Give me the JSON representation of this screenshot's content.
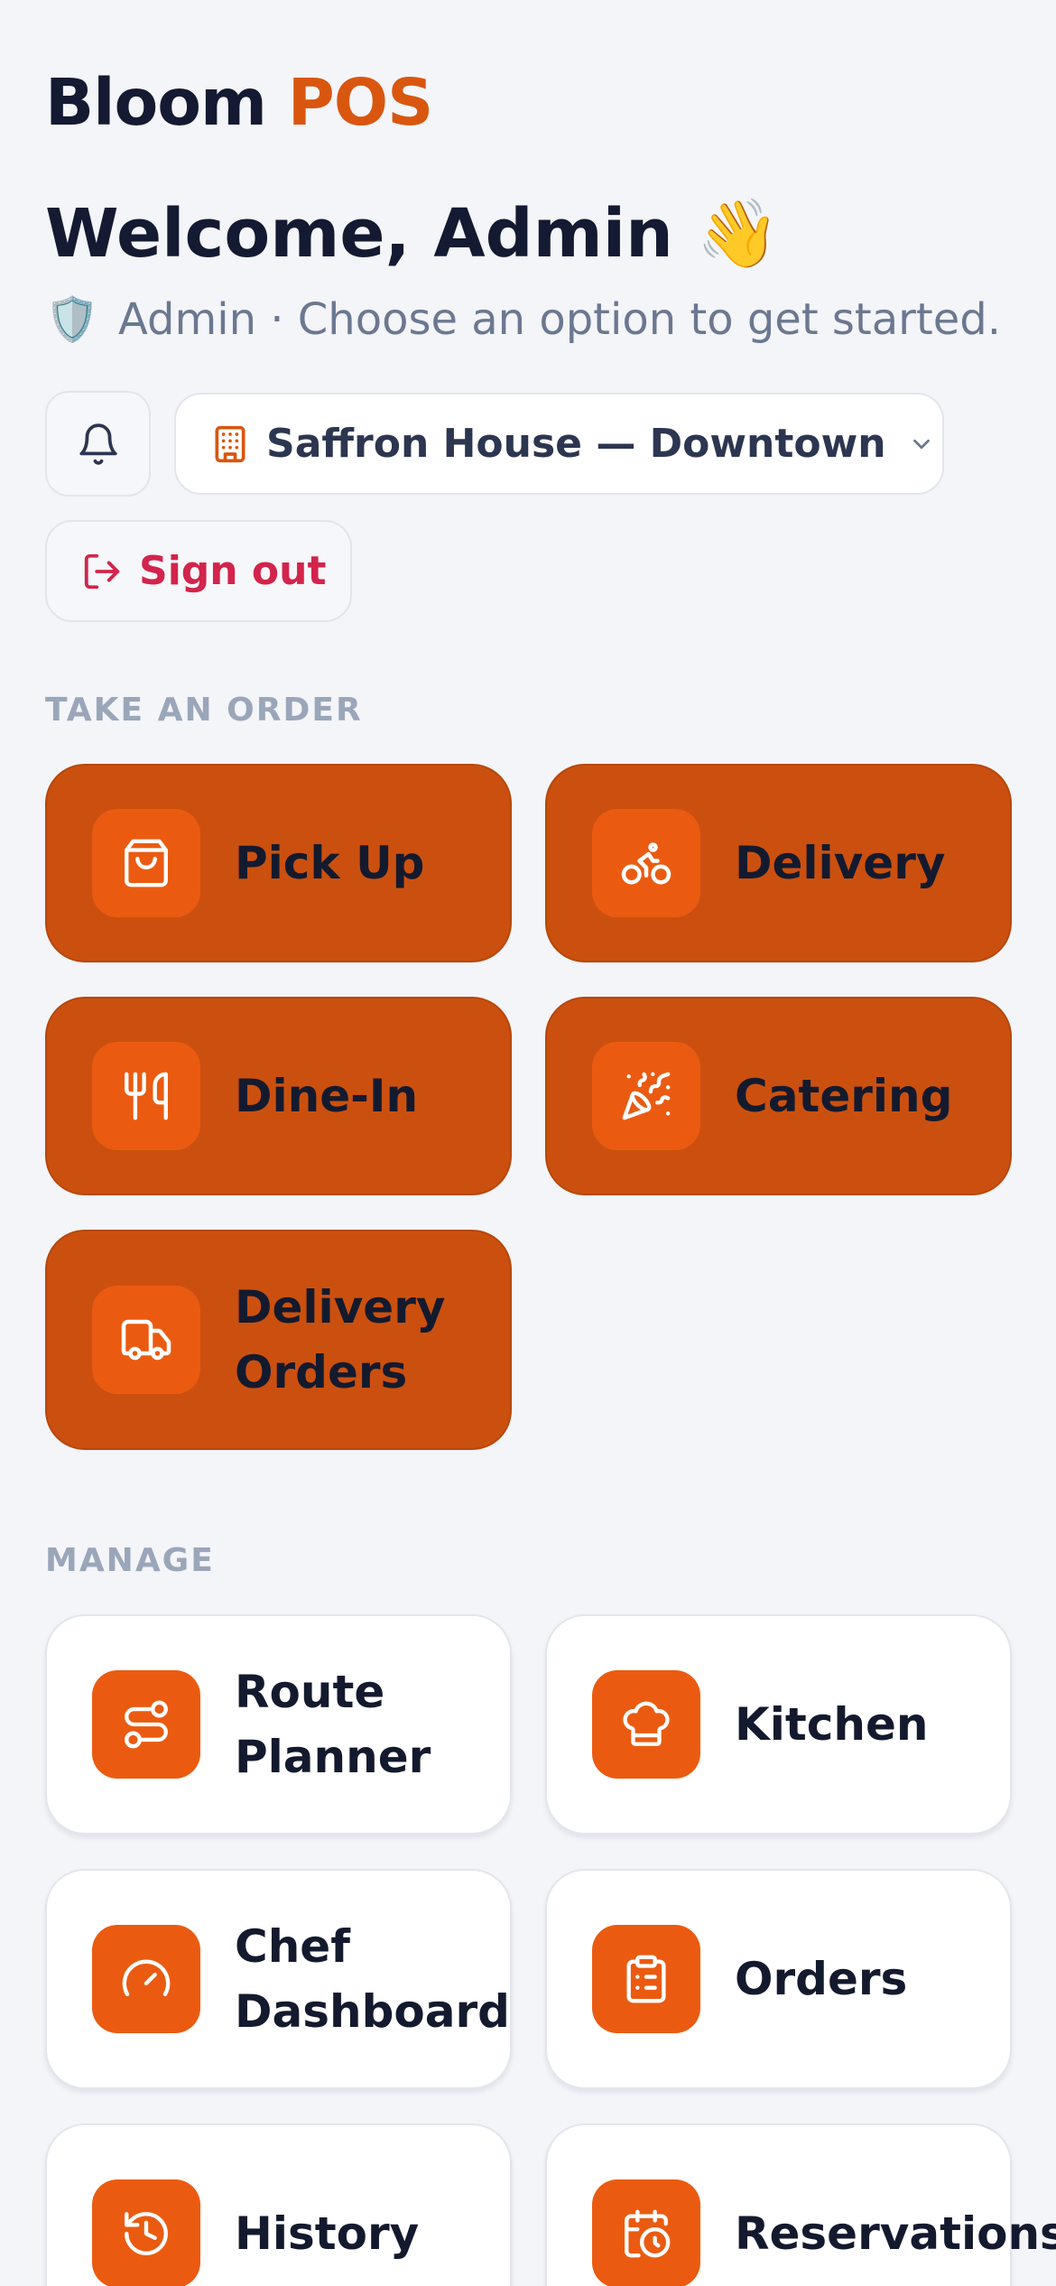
{
  "brand": {
    "name": "Bloom",
    "accent": "POS"
  },
  "welcome": {
    "title": "Welcome, Admin",
    "emoji": "👋"
  },
  "subtitle": {
    "shield": "🛡️",
    "text": "Admin · Choose an option to get started."
  },
  "location": {
    "label": "Saffron House — Downtown"
  },
  "signout": {
    "label": "Sign out"
  },
  "sections": {
    "order": "TAKE AN ORDER",
    "manage": "MANAGE"
  },
  "order_cards": [
    {
      "label": "Pick Up",
      "icon": "shopping-bag-icon"
    },
    {
      "label": "Delivery",
      "icon": "bicycle-icon"
    },
    {
      "label": "Dine-In",
      "icon": "utensils-icon"
    },
    {
      "label": "Catering",
      "icon": "party-popper-icon"
    },
    {
      "label": "Delivery Orders",
      "icon": "truck-icon"
    }
  ],
  "manage_cards": [
    {
      "label": "Route Planner",
      "icon": "route-icon"
    },
    {
      "label": "Kitchen",
      "icon": "chef-hat-icon"
    },
    {
      "label": "Chef Dashboard",
      "icon": "gauge-icon"
    },
    {
      "label": "Orders",
      "icon": "clipboard-list-icon"
    },
    {
      "label": "History",
      "icon": "history-icon"
    },
    {
      "label": "Reservations",
      "icon": "calendar-clock-icon"
    }
  ],
  "colors": {
    "accent": "#d9560f",
    "order_card": "#cb500f",
    "icon_box": "#ea5b11",
    "signout": "#d3244c"
  }
}
